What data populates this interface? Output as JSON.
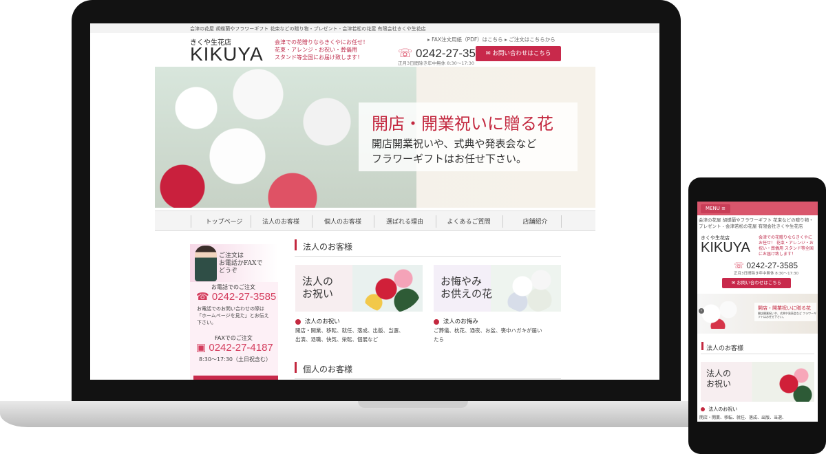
{
  "topbar": {
    "text": "会津の花屋 胡蝶蘭やフラワーギフト 花束などの贈り物・プレゼント - 会津若松の花屋 有限会社きくや生花店"
  },
  "header": {
    "shop_kana": "きくや生花店",
    "brand": "KIKUYA",
    "tagline": [
      "会津での花贈りならきくやにお任せ！",
      "花束・アレンジ・お祝い・葬儀用",
      "スタンド等全国にお届け致します！"
    ],
    "fax_link": "FAX注文用紙（PDF）はこちら",
    "order_link": "ご注文はこちらから",
    "phone": "0242-27-3585",
    "hours": "正月3日間除き年中無休 8:30〜17:30",
    "contact_button": "お問い合わせはこちら"
  },
  "hero": {
    "title": "開店・開業祝いに贈る花",
    "sub1": "開店開業祝いや、式典や発表会など",
    "sub2": "フラワーギフトはお任せ下さい。"
  },
  "nav": {
    "items": [
      "トップページ",
      "法人のお客様",
      "個人のお客様",
      "選ばれる理由",
      "よくあるご質問",
      "店舗紹介"
    ]
  },
  "sidebar": {
    "note": [
      "ご注文は",
      "お電話かFAXで",
      "どうぞ"
    ],
    "phone_heading": "お電話でのご注文",
    "phone": "0242-27-3585",
    "phone_text": [
      "お電話でのお問い合わせの際は",
      "「ホームページを見た」とお伝え",
      "下さい。"
    ],
    "fax_heading": "FAXでのご注文",
    "fax": "0242-27-4187",
    "fax_hours": "8:30〜17:30（土日祝含む）"
  },
  "main": {
    "section1_title": "法人のお客様",
    "section2_title": "個人のお客様",
    "cards": [
      {
        "title_line1": "法人の",
        "title_line2": "お祝い",
        "heading": "法人のお祝い",
        "body1": "開店・開業、移転、就任、落成、出版、当選、",
        "body2": "出演、退職、快気、栄転、個展など"
      },
      {
        "title_line1": "お悔やみ",
        "title_line2": "お供えの花",
        "heading": "法人のお悔み",
        "body1": "ご葬儀、枕花、通夜、お盆、喪中ハガキが届い",
        "body2": "たら"
      }
    ]
  },
  "mobile": {
    "menu": "MENU",
    "topline": "会津の花屋 胡蝶蘭やフラワーギフト 花束などの贈り物・プレゼント - 会津若松の花屋 有限会社きくや生花店",
    "shop_kana": "きくや生花店",
    "brand": "KIKUYA",
    "tagline": "会津での花贈りならきくやにお任せ！ 花束・アレンジ・お祝い・葬儀用 スタンド等全国にお届け致します！",
    "phone": "0242-27-3585",
    "hours": "正月3日間除き年中無休 8:30〜17:30",
    "contact_button": "お問い合わせはこちら",
    "hero_title": "開店・開業祝いに贈る花",
    "hero_sub": "開店開業祝いや、式典や発表会など フラワーギフトはお任せ下さい。",
    "section_title": "法人のお客様",
    "card_title_line1": "法人の",
    "card_title_line2": "お祝い",
    "card_heading": "法人のお祝い",
    "card_body": "開店・開業、移転、就任、落成、出版、当選、"
  },
  "colors": {
    "accent": "#c8294b",
    "menu_bar": "#d9566c",
    "hero_title": "#c3283f"
  },
  "icons": [
    "phone-icon",
    "mail-icon",
    "fax-icon",
    "menu-icon",
    "arrow-icon"
  ]
}
